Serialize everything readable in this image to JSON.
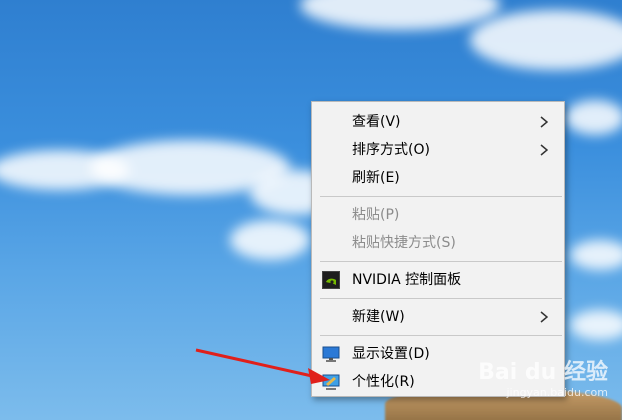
{
  "context_menu": {
    "items": [
      {
        "label": "查看(V)",
        "submenu": true,
        "enabled": true
      },
      {
        "label": "排序方式(O)",
        "submenu": true,
        "enabled": true
      },
      {
        "label": "刷新(E)",
        "submenu": false,
        "enabled": true
      },
      {
        "label": "粘贴(P)",
        "submenu": false,
        "enabled": false
      },
      {
        "label": "粘贴快捷方式(S)",
        "submenu": false,
        "enabled": false
      },
      {
        "label": "NVIDIA 控制面板",
        "submenu": false,
        "enabled": true,
        "icon": "nvidia-icon"
      },
      {
        "label": "新建(W)",
        "submenu": true,
        "enabled": true
      },
      {
        "label": "显示设置(D)",
        "submenu": false,
        "enabled": true,
        "icon": "display-icon"
      },
      {
        "label": "个性化(R)",
        "submenu": false,
        "enabled": true,
        "icon": "personalize-icon"
      }
    ]
  },
  "watermark": {
    "logo": "Bai du 经验",
    "url": "jingyan.baidu.com"
  },
  "colors": {
    "annotation_arrow": "#e0201b",
    "menu_bg": "#f2f2f2",
    "disabled_text": "#8c8c8c"
  }
}
